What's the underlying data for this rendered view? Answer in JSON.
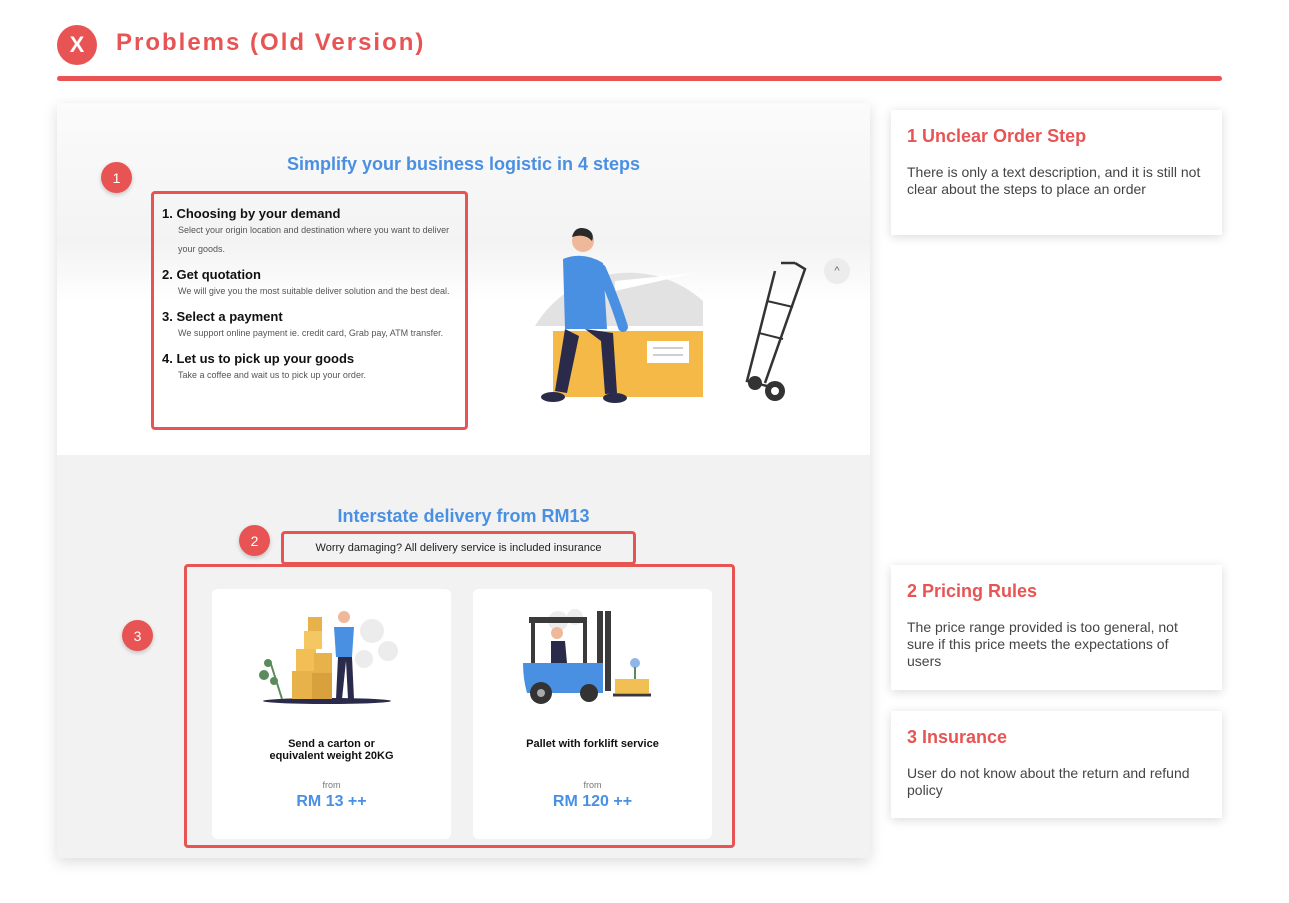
{
  "header": {
    "close_glyph": "X",
    "title": "Problems (Old Version)"
  },
  "colors": {
    "accent_red": "#e85454",
    "brand_blue": "#4a90e2"
  },
  "section_steps": {
    "title": "Simplify your business logistic in 4 steps",
    "steps": [
      {
        "heading": "1. Choosing by your demand",
        "desc": "Select your origin location and destination where you want to deliver your goods."
      },
      {
        "heading": "2. Get quotation",
        "desc": "We will give you the most suitable deliver solution and the best deal."
      },
      {
        "heading": "3. Select a payment",
        "desc": "We support online payment ie. credit card, Grab pay, ATM transfer."
      },
      {
        "heading": "4. Let us to pick up your goods",
        "desc": "Take a coffee and wait us to pick up your order."
      }
    ]
  },
  "section_delivery": {
    "title": "Interstate delivery from RM13",
    "insurance_text": "Worry damaging? All delivery service is included insurance",
    "cards": [
      {
        "title_line1": "Send a carton or",
        "title_line2": "equivalent weight 20KG",
        "from_label": "from",
        "price": "RM 13 ++"
      },
      {
        "title_line1": "Pallet with forklift service",
        "title_line2": "",
        "from_label": "from",
        "price": "RM 120 ++"
      }
    ]
  },
  "badges": [
    "1",
    "2",
    "3"
  ],
  "notes": [
    {
      "title": "1 Unclear Order Step",
      "text": "There is only a text description, and it is still not clear about the steps to place an order"
    },
    {
      "title": "2 Pricing Rules",
      "text": "The price range provided is too general, not sure if this price meets the expectations of users"
    },
    {
      "title": "3 Insurance",
      "text": "User do not know about the return and refund policy"
    }
  ]
}
